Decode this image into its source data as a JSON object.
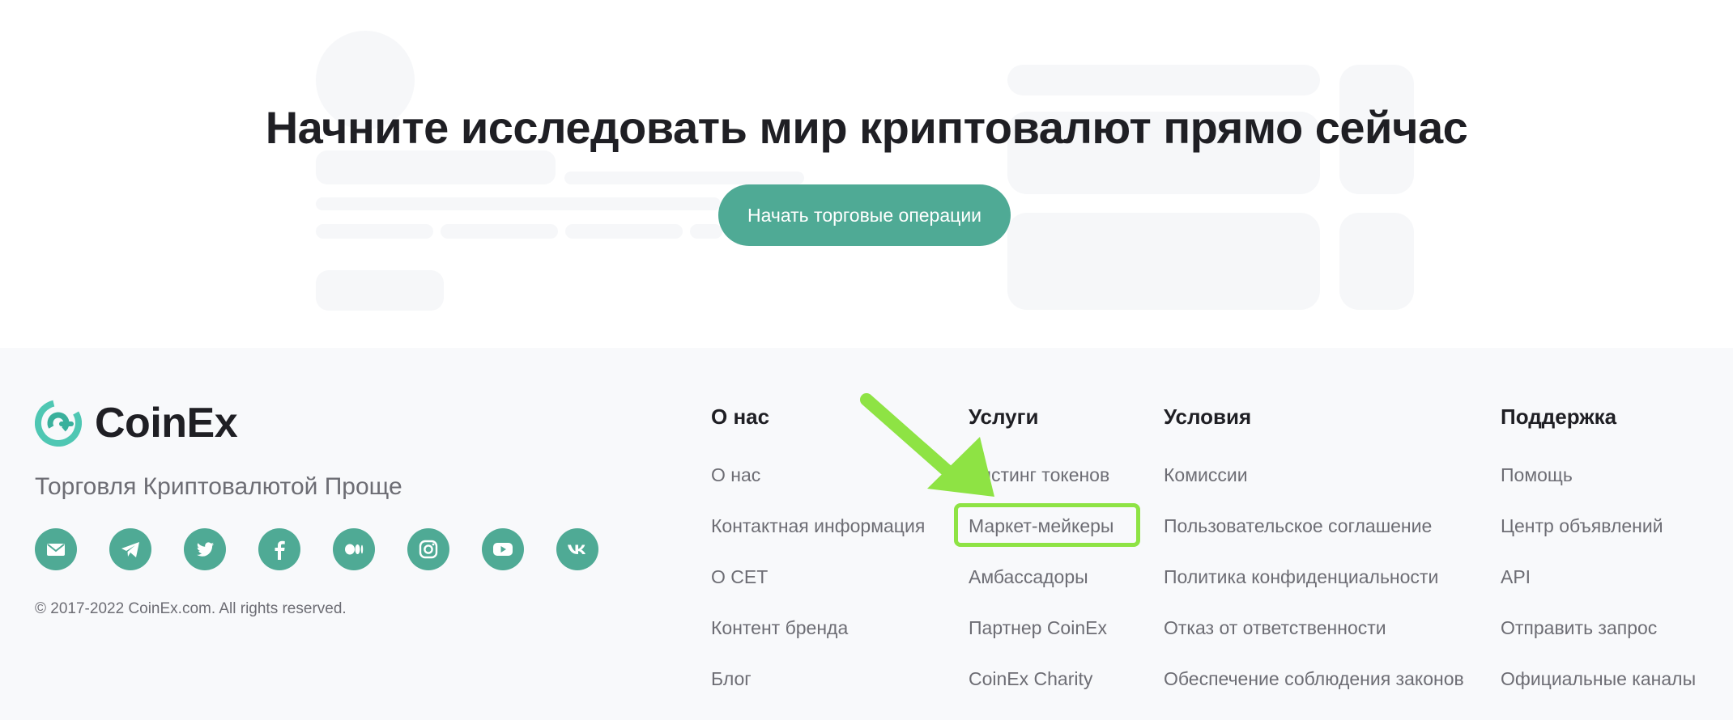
{
  "hero": {
    "title": "Начните исследовать мир криптовалют прямо сейчас",
    "cta_label": "Начать торговые операции"
  },
  "brand": {
    "name": "CoinEx",
    "tagline": "Торговля Криптовалютой Проще",
    "copyright": "© 2017-2022 CoinEx.com. All rights reserved."
  },
  "socials": [
    {
      "icon": "mail-icon"
    },
    {
      "icon": "telegram-icon"
    },
    {
      "icon": "twitter-icon"
    },
    {
      "icon": "facebook-icon"
    },
    {
      "icon": "medium-icon"
    },
    {
      "icon": "instagram-icon"
    },
    {
      "icon": "youtube-icon"
    },
    {
      "icon": "vk-icon"
    }
  ],
  "columns": [
    {
      "title": "О нас",
      "links": [
        "О нас",
        "Контактная информация",
        "О CET",
        "Контент бренда",
        "Блог"
      ]
    },
    {
      "title": "Услуги",
      "links": [
        "Листинг токенов",
        "Маркет-мейкеры",
        "Амбассадоры",
        "Партнер CoinEx",
        "CoinEx Charity"
      ]
    },
    {
      "title": "Условия",
      "links": [
        "Комиссии",
        "Пользовательское соглашение",
        "Политика конфиденциальности",
        "Отказ от ответственности",
        "Обеспечение соблюдения законов"
      ]
    },
    {
      "title": "Поддержка",
      "links": [
        "Помощь",
        "Центр объявлений",
        "API",
        "Отправить запрос",
        "Официальные каналы"
      ]
    }
  ],
  "colors": {
    "accent": "#4faa95",
    "highlight": "#8ee344",
    "footer_bg": "#f8f9fb",
    "text_muted": "#6d6d74"
  }
}
